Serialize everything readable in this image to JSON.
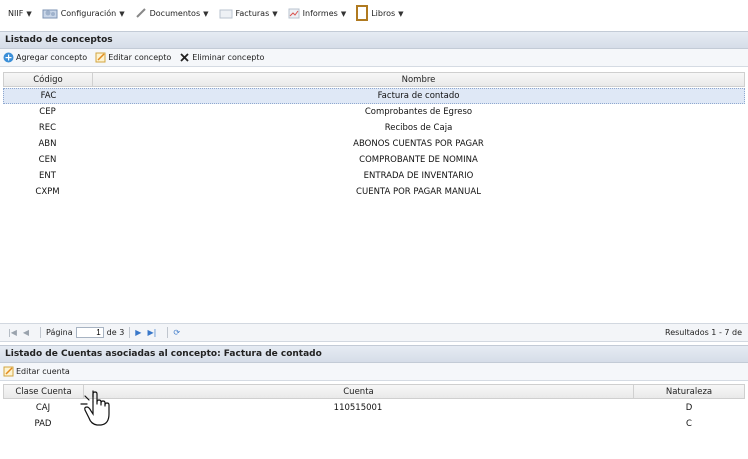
{
  "menubar": {
    "items": [
      {
        "label": "NIIF",
        "icon": "none"
      },
      {
        "label": "Configuración",
        "icon": "config-icon"
      },
      {
        "label": "Documentos",
        "icon": "pencil-icon"
      },
      {
        "label": "Facturas",
        "icon": "invoice-icon"
      },
      {
        "label": "Informes",
        "icon": "chart-icon"
      },
      {
        "label": "Libros",
        "icon": "book-icon"
      }
    ]
  },
  "conceptos": {
    "title": "Listado de conceptos",
    "toolbar": {
      "add_label": "Agregar concepto",
      "edit_label": "Editar concepto",
      "delete_label": "Eliminar concepto"
    },
    "columns": [
      "Código",
      "Nombre"
    ],
    "rows": [
      {
        "codigo": "FAC",
        "nombre": "Factura de contado",
        "selected": true
      },
      {
        "codigo": "CEP",
        "nombre": "Comprobantes de Egreso",
        "selected": false
      },
      {
        "codigo": "REC",
        "nombre": "Recibos de Caja",
        "selected": false
      },
      {
        "codigo": "ABN",
        "nombre": "ABONOS CUENTAS POR PAGAR",
        "selected": false
      },
      {
        "codigo": "CEN",
        "nombre": "COMPROBANTE DE NOMINA",
        "selected": false
      },
      {
        "codigo": "ENT",
        "nombre": "ENTRADA DE INVENTARIO",
        "selected": false
      },
      {
        "codigo": "CXPM",
        "nombre": "CUENTA POR PAGAR MANUAL",
        "selected": false
      }
    ],
    "pager": {
      "page_label": "Página",
      "page_value": "1",
      "of_label": "de 3",
      "results": "Resultados 1 - 7 de"
    }
  },
  "cuentas": {
    "title": "Listado de Cuentas asociadas al concepto: Factura de contado",
    "toolbar": {
      "edit_label": "Editar cuenta"
    },
    "columns": [
      "Clase Cuenta",
      "Cuenta",
      "Naturaleza"
    ],
    "rows": [
      {
        "clase": "CAJ",
        "cuenta": "110515001",
        "naturaleza": "D"
      },
      {
        "clase": "PAD",
        "cuenta": "",
        "naturaleza": "C"
      }
    ]
  },
  "colors": {
    "selection": "#dfe8f6",
    "header": "#d6dde8",
    "accent": "#3a78c9"
  }
}
